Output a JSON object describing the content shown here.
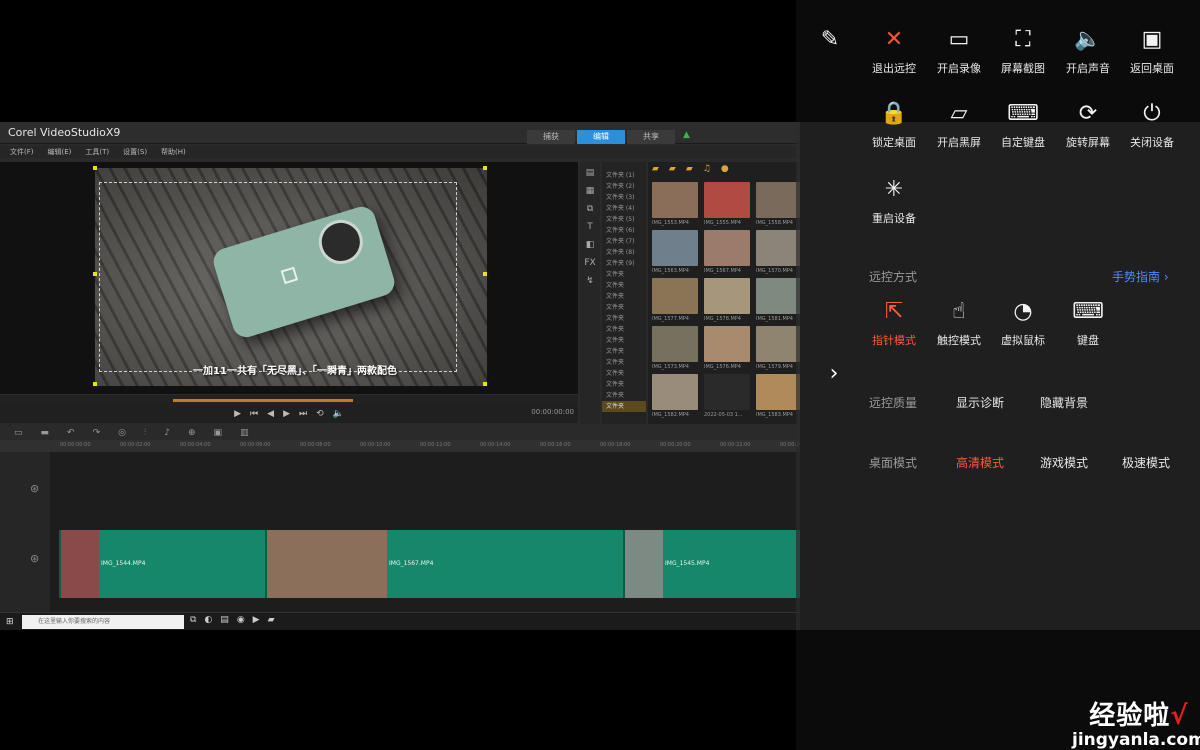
{
  "app": {
    "title": "Corel VideoStudioX9",
    "steps": [
      "捕获",
      "编辑",
      "共享"
    ],
    "active_step": 1,
    "menu": [
      "文件(F)",
      "编辑(E)",
      "工具(T)",
      "设置(S)",
      "帮助(H)"
    ]
  },
  "preview": {
    "subtitle": "一加11一共有「无尽黑」、「一瞬青」两款配色",
    "timecode": "00:00:00:00",
    "trim_range_pct": [
      30,
      61
    ]
  },
  "library": {
    "folders": [
      "文件夹 (1)",
      "文件夹 (2)",
      "文件夹 (3)",
      "文件夹 (4)",
      "文件夹 (5)",
      "文件夹 (6)",
      "文件夹 (7)",
      "文件夹 (8)",
      "文件夹 (9)",
      "文件夹",
      "文件夹",
      "文件夹",
      "文件夹",
      "文件夹",
      "文件夹",
      "文件夹",
      "文件夹",
      "文件夹",
      "文件夹",
      "文件夹",
      "文件夹",
      "文件夹"
    ],
    "selected_folder": 21,
    "thumbs": [
      {
        "caption": "IMG_1553.MP4",
        "color": "#8a6e5a"
      },
      {
        "caption": "IMG_1555.MP4",
        "color": "#b24a44"
      },
      {
        "caption": "IMG_1558.MP4",
        "color": "#7a6a5c"
      },
      {
        "caption": "IMG_1563.MP4",
        "color": "#6f7f8c"
      },
      {
        "caption": "IMG_1567.MP4",
        "color": "#9b7c6a"
      },
      {
        "caption": "IMG_1570.MP4",
        "color": "#8c8478"
      },
      {
        "caption": "IMG_1577.MP4",
        "color": "#8a7456"
      },
      {
        "caption": "IMG_1578.MP4",
        "color": "#a6967c"
      },
      {
        "caption": "IMG_1581.MP4",
        "color": "#7e8a80"
      },
      {
        "caption": "IMG_1573.MP4",
        "color": "#76705e"
      },
      {
        "caption": "IMG_1576.MP4",
        "color": "#a88a6e"
      },
      {
        "caption": "IMG_1579.MP4",
        "color": "#8f8470"
      },
      {
        "caption": "IMG_1582.MP4",
        "color": "#9a8c7a"
      },
      {
        "caption": "2022-05-03 1...",
        "color": "#2a2a2a"
      },
      {
        "caption": "IMG_1583.MP4",
        "color": "#b08a5a"
      }
    ]
  },
  "timeline": {
    "ruler": [
      "00:00:00:00",
      "00:00:02:00",
      "00:00:04:00",
      "00:00:06:00",
      "00:00:08:00",
      "00:00:10:00",
      "00:00:12:00",
      "00:00:14:00",
      "00:00:16:00",
      "00:00:18:00",
      "00:00:20:00",
      "00:00:22:00",
      "00:00:24:00",
      "00:00:26:00"
    ],
    "clips": [
      {
        "name": "IMG_1544.MP4",
        "thumb_color": "#8a4a4a"
      },
      {
        "name": "IMG_1567.MP4",
        "thumb_color": "#8b6f5a"
      },
      {
        "name": "IMG_1545.MP4",
        "thumb_color": "#7d8a84"
      }
    ]
  },
  "taskbar": {
    "search_placeholder": "在这里输入你要搜索的内容"
  },
  "panel": {
    "tools_row1": [
      {
        "icon": "edit-icon",
        "glyph": "✎",
        "label": ""
      },
      {
        "icon": "close-icon",
        "glyph": "✕",
        "label": "退出远控"
      },
      {
        "icon": "video-camera-icon",
        "glyph": "▭",
        "label": "开启录像"
      },
      {
        "icon": "crop-icon",
        "glyph": "⛶",
        "label": "屏幕截图"
      },
      {
        "icon": "speaker-icon",
        "glyph": "🔈",
        "label": "开启声音"
      },
      {
        "icon": "monitor-icon",
        "glyph": "▣",
        "label": "返回桌面"
      }
    ],
    "tools_row2": [
      {
        "icon": "lock-icon",
        "glyph": "🔒",
        "label": "锁定桌面"
      },
      {
        "icon": "blackscreen-icon",
        "glyph": "▱",
        "label": "开启黑屏"
      },
      {
        "icon": "keyboard-icon",
        "glyph": "⌨",
        "label": "自定键盘"
      },
      {
        "icon": "rotate-icon",
        "glyph": "⟳",
        "label": "旋转屏幕"
      },
      {
        "icon": "power-icon",
        "glyph": "⏻",
        "label": "关闭设备"
      }
    ],
    "tools_row3": [
      {
        "icon": "restart-icon",
        "glyph": "✳",
        "label": "重启设备"
      }
    ],
    "control_mode": {
      "label": "远控方式",
      "guide_link": "手势指南",
      "options": [
        {
          "icon": "pointer-icon",
          "glyph": "⇱",
          "label": "指针模式"
        },
        {
          "icon": "touch-icon",
          "glyph": "☝",
          "label": "触控模式"
        },
        {
          "icon": "virtual-mouse-icon",
          "glyph": "◔",
          "label": "虚拟鼠标"
        },
        {
          "icon": "keyboard-icon",
          "glyph": "⌨",
          "label": "键盘"
        }
      ],
      "active": 0
    },
    "quality": {
      "label": "远控质量",
      "options": [
        "显示诊断",
        "隐藏背景"
      ]
    },
    "desktop_mode": {
      "label": "桌面模式",
      "options": [
        "高清模式",
        "游戏模式",
        "极速模式"
      ],
      "active": 0
    },
    "collapse_glyph": "›"
  },
  "watermark": {
    "text": "经验啦",
    "check": "√",
    "url": "jingyanla.com"
  },
  "colors": {
    "accent": "#ff5a3c",
    "link": "#4c8dff",
    "clip": "#17876a"
  }
}
